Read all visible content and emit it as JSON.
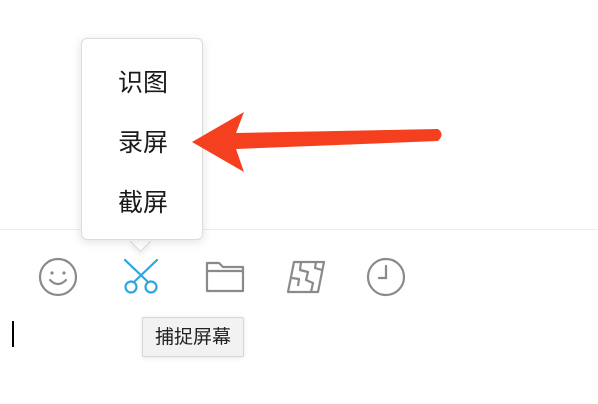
{
  "popup_menu": {
    "items": [
      {
        "label": "识图"
      },
      {
        "label": "录屏"
      },
      {
        "label": "截屏"
      }
    ]
  },
  "toolbar": {
    "icons": [
      {
        "name": "emoji-icon"
      },
      {
        "name": "scissors-icon",
        "active": true
      },
      {
        "name": "folder-icon"
      },
      {
        "name": "map-icon"
      },
      {
        "name": "clock-icon"
      }
    ],
    "active_color": "#2aa6e0",
    "icon_color": "#8a8a8a"
  },
  "tooltip": {
    "text": "捕捉屏幕"
  },
  "annotation": {
    "arrow_color": "#f4401f"
  }
}
